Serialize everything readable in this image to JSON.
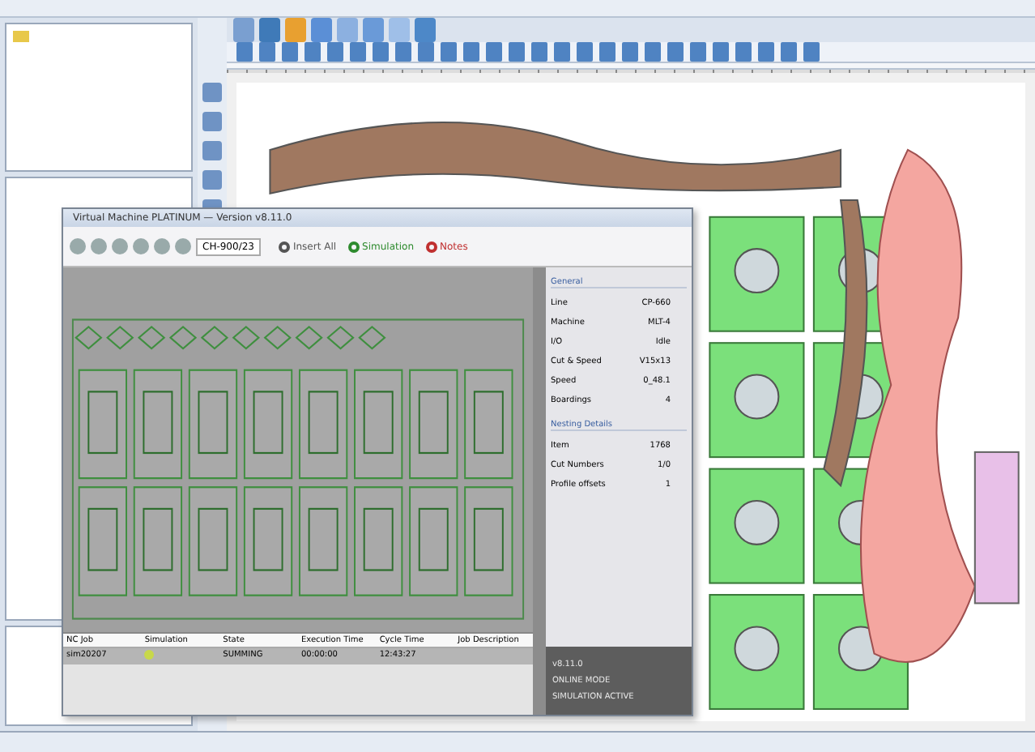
{
  "dialog": {
    "title": "Virtual Machine PLATINUM — Version v8.11.0",
    "combo": "CH-900/23",
    "tools": [
      {
        "label": "Insert All",
        "kind": "plain"
      },
      {
        "label": "Simulation",
        "kind": "green"
      },
      {
        "label": "Notes",
        "kind": "red"
      }
    ]
  },
  "properties": [
    {
      "title": "General",
      "rows": [
        {
          "label": "Line",
          "value": "CP-660"
        },
        {
          "label": "Machine",
          "value": "MLT-4"
        },
        {
          "label": "I/O",
          "value": "Idle"
        },
        {
          "label": "Cut & Speed",
          "value": "V15x13"
        },
        {
          "label": "Speed",
          "value": "0_48.1"
        },
        {
          "label": "Boardings",
          "value": "4"
        }
      ]
    },
    {
      "title": "Nesting Details",
      "rows": [
        {
          "label": "Item",
          "value": "1768"
        },
        {
          "label": "Cut Numbers",
          "value": "1/0"
        },
        {
          "label": "Profile offsets",
          "value": "1"
        }
      ]
    }
  ],
  "footer_lines": [
    "v8.11.0",
    "ONLINE MODE",
    "SIMULATION ACTIVE"
  ],
  "jobs": {
    "columns": [
      "NC Job",
      "Simulation",
      "State",
      "Execution Time",
      "Cycle Time",
      "Job Description"
    ],
    "rows": [
      {
        "cells": [
          "sim20207",
          "",
          "SUMMING",
          "00:00:00",
          "12:43:27",
          ""
        ],
        "selected": true
      }
    ]
  }
}
